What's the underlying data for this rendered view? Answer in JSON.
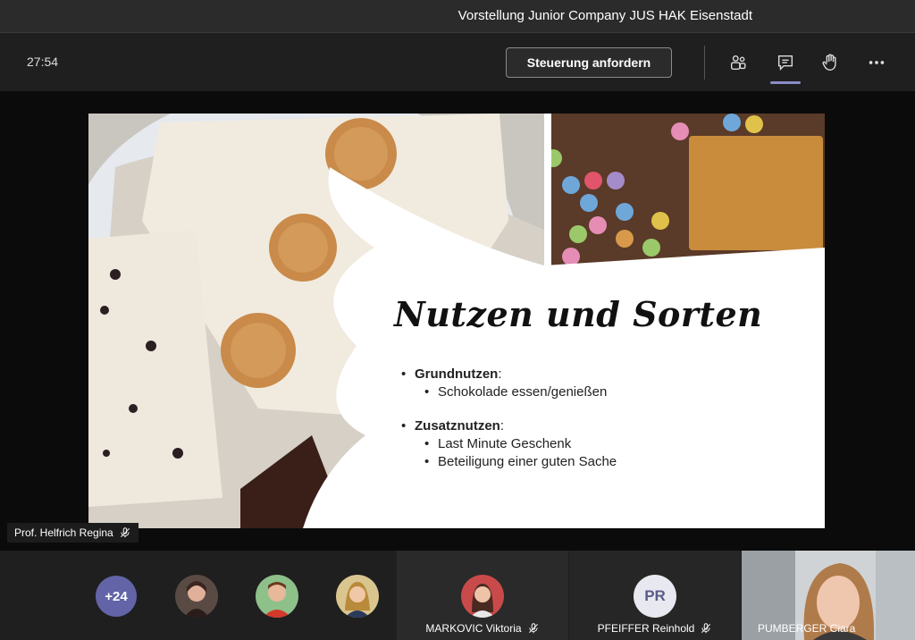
{
  "window": {
    "title": "Vorstellung Junior Company JUS HAK Eisenstadt"
  },
  "toolbar": {
    "timer": "27:54",
    "request_control_label": "Steuerung anfordern",
    "icons": [
      "participants-icon",
      "chat-icon",
      "raise-hand-icon",
      "more-options-icon"
    ]
  },
  "slide": {
    "title": "Nutzen und Sorten",
    "sections": [
      {
        "heading": "Grundnutzen",
        "suffix": ":",
        "items": [
          "Schokolade essen/genießen"
        ]
      },
      {
        "heading": "Zusatznutzen",
        "suffix": ":",
        "items": [
          "Last Minute Geschenk",
          "Beteiligung einer guten Sache"
        ]
      }
    ]
  },
  "presenter": {
    "name": "Prof. Helfrich Regina"
  },
  "participants": {
    "overflow_count": "+24",
    "tiles": [
      {
        "name": "MARKOVIC Viktoria"
      },
      {
        "name": "PFEIFFER Reinhold",
        "initials": "PR"
      },
      {
        "name": "PUMBERGER Ciara"
      }
    ]
  },
  "colors": {
    "accent": "#6264a7",
    "background": "#1f1f1f"
  }
}
